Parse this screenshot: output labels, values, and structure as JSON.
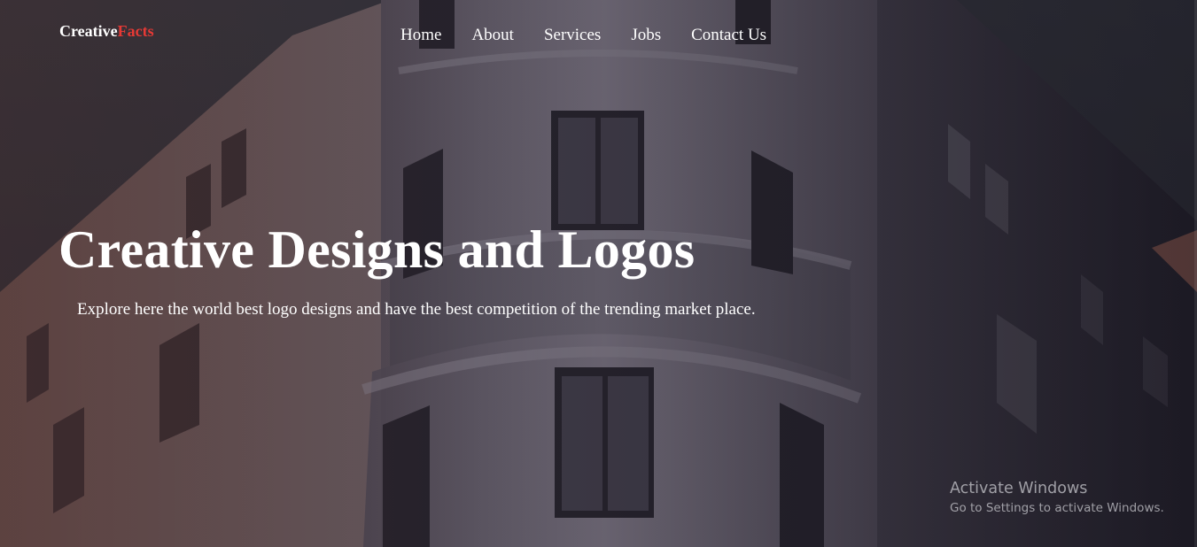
{
  "brand": {
    "name_main": "Creative",
    "name_accent": "Facts",
    "accent_color": "#e53935"
  },
  "nav": {
    "items": [
      {
        "label": "Home"
      },
      {
        "label": "About"
      },
      {
        "label": "Services"
      },
      {
        "label": "Jobs"
      },
      {
        "label": "Contact Us"
      }
    ]
  },
  "hero": {
    "title": "Creative Designs and Logos",
    "subtitle": "Explore here the world best logo designs and have the best competition of the trending market place.",
    "background": "building-photo"
  },
  "watermark": {
    "title": "Activate Windows",
    "subtitle": "Go to Settings to activate Windows."
  }
}
